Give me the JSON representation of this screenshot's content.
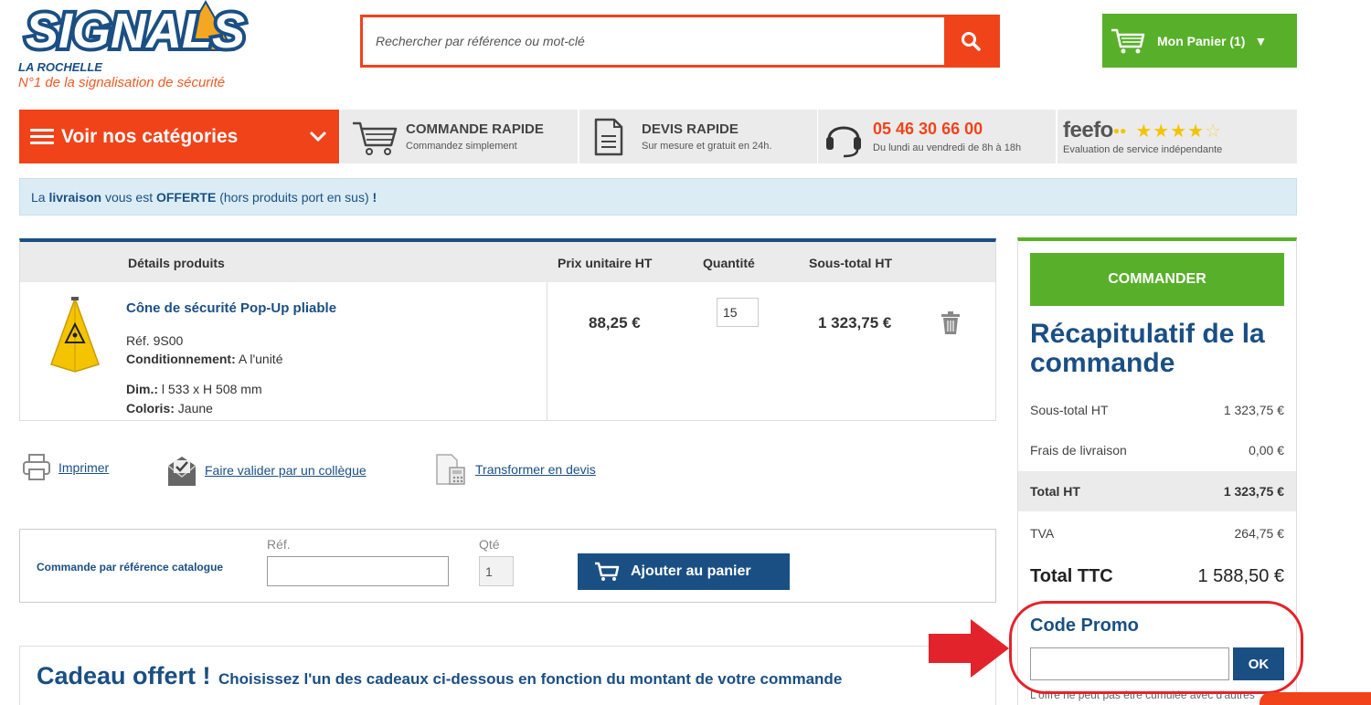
{
  "header": {
    "logo_brand": "SIGNALS",
    "logo_city": "LA ROCHELLE",
    "logo_tagline": "N°1 de la signalisation de sécurité",
    "search_placeholder": "Rechercher par référence ou mot-clé",
    "cart_label": "Mon Panier (1)"
  },
  "nav": {
    "categories_label": "Voir nos catégories",
    "quick_order": {
      "title": "COMMANDE RAPIDE",
      "subtitle": "Commandez simplement"
    },
    "quick_quote": {
      "title": "DEVIS RAPIDE",
      "subtitle": "Sur mesure et gratuit en 24h."
    },
    "phone": {
      "number": "05 46 30 66 00",
      "subtitle": "Du lundi au vendredi de 8h à 18h"
    },
    "feefo": {
      "brand": "feefo",
      "subtitle": "Evaluation de service indépendante",
      "stars": 4.5
    }
  },
  "banner": {
    "t1": "La ",
    "t2": "livraison",
    "t3": " vous est ",
    "t4": "OFFERTE",
    "t5": " (hors produits port en sus) ",
    "t6": "!"
  },
  "cart": {
    "headers": {
      "details": "Détails produits",
      "unit_price": "Prix unitaire HT",
      "quantity": "Quantité",
      "subtotal": "Sous-total HT"
    },
    "item": {
      "name": "Cône de sécurité Pop-Up pliable",
      "ref": "Réf. 9S00",
      "packaging_label": "Conditionnement:",
      "packaging_value": " A l'unité",
      "dim_label": "Dim.:",
      "dim_value": " l 533 x H 508 mm",
      "color_label": "Coloris:",
      "color_value": " Jaune",
      "unit_price": "88,25 €",
      "quantity": "15",
      "subtotal": "1 323,75 €"
    }
  },
  "actions": {
    "print": "Imprimer",
    "validate": "Faire valider par un collègue",
    "quote": "Transformer en devis"
  },
  "quick_order_form": {
    "label": "Commande par référence catalogue",
    "ref_label": "Réf.",
    "qty_label": "Qté",
    "qty_value": "1",
    "add_button": "Ajouter au panier"
  },
  "gift": {
    "title": "Cadeau offert !",
    "subtitle": "Choisissez l'un des cadeaux ci-dessous en fonction du montant de votre commande"
  },
  "summary": {
    "order_button": "COMMANDER",
    "title": "Récapitulatif de la commande",
    "rows": [
      {
        "label": "Sous-total HT",
        "value": "1 323,75 €"
      },
      {
        "label": "Frais de livraison",
        "value": "0,00 €"
      },
      {
        "label": "Total HT",
        "value": "1 323,75 €"
      },
      {
        "label": "TVA",
        "value": "264,75 €"
      },
      {
        "label": "Total TTC",
        "value": "1 588,50 €"
      }
    ],
    "promo_title": "Code Promo",
    "promo_button": "OK",
    "promo_note": "L'offre ne peut pas être cumulée avec d'autres réductions en cours ou offres promotionnelles."
  },
  "colors": {
    "brand_orange": "#f0431a",
    "brand_blue": "#1a4f84",
    "green": "#58b02a",
    "annotation_red": "#e3232b"
  }
}
